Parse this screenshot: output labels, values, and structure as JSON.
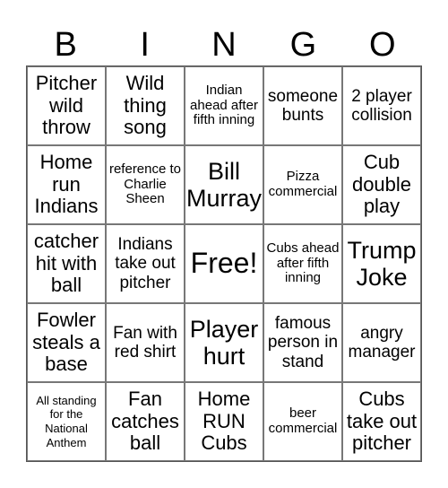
{
  "header": [
    "B",
    "I",
    "N",
    "G",
    "O"
  ],
  "cells": [
    {
      "text": "Pitcher wild throw",
      "size": "lg"
    },
    {
      "text": "Wild thing song",
      "size": "lg"
    },
    {
      "text": "Indian ahead after fifth inning",
      "size": "sm"
    },
    {
      "text": "someone bunts",
      "size": "md"
    },
    {
      "text": "2 player collision",
      "size": "md"
    },
    {
      "text": "Home run Indians",
      "size": "lg"
    },
    {
      "text": "reference to Charlie Sheen",
      "size": "sm"
    },
    {
      "text": "Bill Murray",
      "size": "xl"
    },
    {
      "text": "Pizza commercial",
      "size": "sm"
    },
    {
      "text": "Cub double play",
      "size": "lg"
    },
    {
      "text": "catcher hit with ball",
      "size": "lg"
    },
    {
      "text": "Indians take out pitcher",
      "size": "md"
    },
    {
      "text": "Free!",
      "size": "xxl"
    },
    {
      "text": "Cubs ahead after fifth inning",
      "size": "sm"
    },
    {
      "text": "Trump Joke",
      "size": "xl"
    },
    {
      "text": "Fowler steals a base",
      "size": "lg"
    },
    {
      "text": "Fan with red shirt",
      "size": "md"
    },
    {
      "text": "Player hurt",
      "size": "xl"
    },
    {
      "text": "famous person in stand",
      "size": "md"
    },
    {
      "text": "angry manager",
      "size": "md"
    },
    {
      "text": "All standing for the National Anthem",
      "size": "xs"
    },
    {
      "text": "Fan catches ball",
      "size": "lg"
    },
    {
      "text": "Home RUN Cubs",
      "size": "lg"
    },
    {
      "text": "beer commercial",
      "size": "sm"
    },
    {
      "text": "Cubs take out pitcher",
      "size": "lg"
    }
  ]
}
